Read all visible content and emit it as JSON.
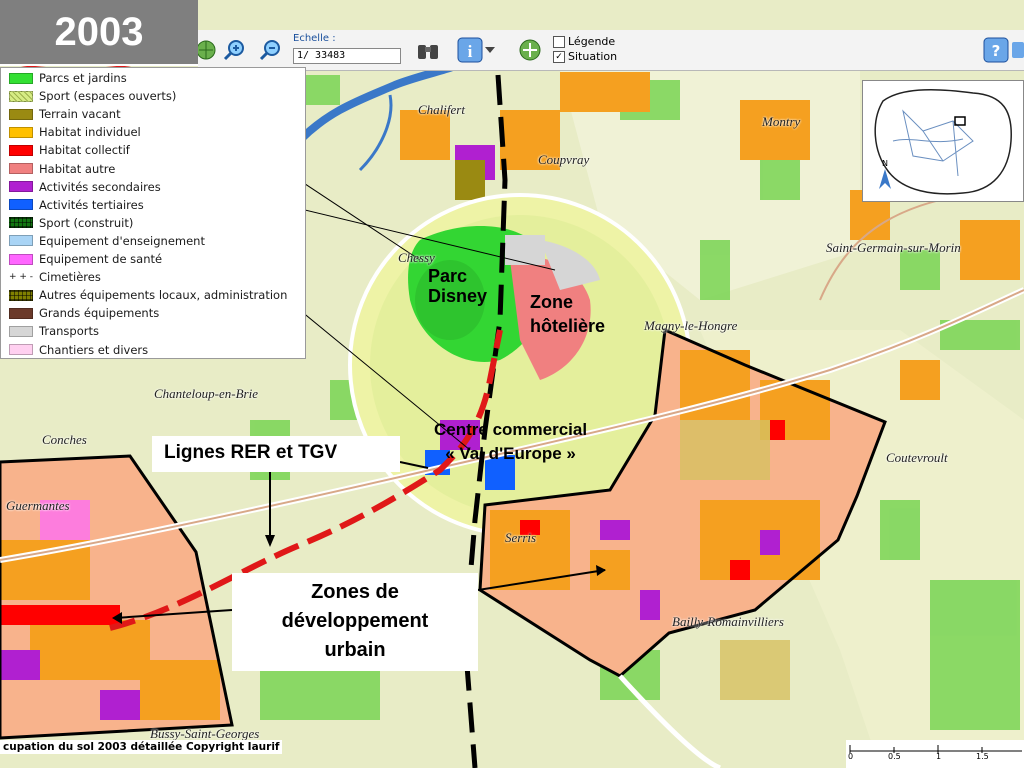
{
  "year": "2003",
  "toolbar": {
    "scale_label": "Echelle :",
    "scale_value": "1/ 33483",
    "legend_toggle": "Légende",
    "situation_toggle": "Situation",
    "legend_checked": false,
    "situation_checked": true,
    "icons": [
      "globe-icon",
      "zoom-in-icon",
      "zoom-out-icon",
      "binoculars-icon",
      "info-icon",
      "dropdown-icon",
      "pan-icon",
      "help-icon",
      "print-icon"
    ]
  },
  "legend": {
    "items": [
      {
        "label": "Parcs et jardins",
        "color": "#33e033"
      },
      {
        "label": "Sport (espaces ouverts)",
        "color": "#d6ec84"
      },
      {
        "label": "Terrain vacant",
        "color": "#9a8a12"
      },
      {
        "label": "Habitat individuel",
        "color": "#ffc000"
      },
      {
        "label": "Habitat collectif",
        "color": "#ff0000"
      },
      {
        "label": "Habitat autre",
        "color": "#f08080"
      },
      {
        "label": "Activités secondaires",
        "color": "#b020d0"
      },
      {
        "label": "Activités tertiaires",
        "color": "#1060ff"
      },
      {
        "label": "Sport (construit)",
        "color": "#117711"
      },
      {
        "label": "Equipement d'enseignement",
        "color": "#a9d4f5"
      },
      {
        "label": "Equipement de santé",
        "color": "#ff66ff"
      },
      {
        "label": "Cimetières",
        "color": "#ffffff"
      },
      {
        "label": "Autres équipements locaux, administration",
        "color": "#808000"
      },
      {
        "label": "Grands équipements",
        "color": "#6b3a2a"
      },
      {
        "label": "Transports",
        "color": "#d6d6d6"
      },
      {
        "label": "Chantiers et divers",
        "color": "#ffd0f0"
      }
    ]
  },
  "places": {
    "chalifert": "Chalifert",
    "montry": "Montry",
    "coupvray": "Coupvray",
    "saint_germain": "Saint-Germain-sur-Morin",
    "chessy": "Chessy",
    "magny": "Magny-le-Hongre",
    "chanteloup": "Chanteloup-en-Brie",
    "conches": "Conches",
    "coutevroult": "Coutevroult",
    "guermantes": "Guermantes",
    "serris": "Serris",
    "bailly": "Bailly-Romainvilliers",
    "bussy": "Bussy-Saint-Georges"
  },
  "annotations": {
    "parc_disney_1": "Parc",
    "parc_disney_2": "Disney",
    "zone_hoteliere_1": "Zone",
    "zone_hoteliere_2": "hôtelière",
    "centre_commercial_1": "Centre commercial",
    "centre_commercial_2": "« Val d'Europe »",
    "lignes": "Lignes RER et TGV",
    "zones_dev_1": "Zones de",
    "zones_dev_2": "développement",
    "zones_dev_3": "urbain"
  },
  "copyright": "cupation du sol 2003 détaillée Copyright Iaurif",
  "scalebar": {
    "ticks": [
      "0",
      "0.5",
      "1",
      "1.5"
    ]
  },
  "minimap": {
    "north": "N"
  }
}
